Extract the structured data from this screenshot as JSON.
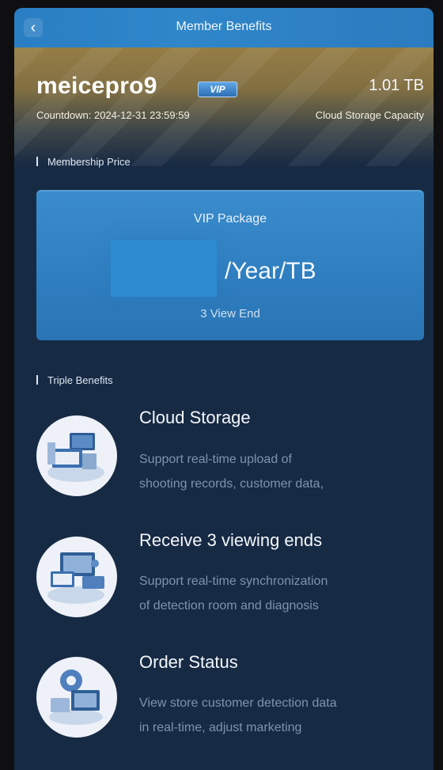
{
  "header": {
    "title": "Member Benefits",
    "back_icon": "chevron-left-icon"
  },
  "profile": {
    "username": "meicepro9",
    "badge": "VIP",
    "capacity": "1.01 TB",
    "countdown": "Countdown: 2024-12-31 23:59:59",
    "capacity_label": "Cloud Storage Capacity"
  },
  "membership_price": {
    "section_title": "Membership Price",
    "package_name": "VIP Package",
    "unit": "/Year/TB",
    "views": "3 View End"
  },
  "triple_benefits": {
    "section_title": "Triple Benefits",
    "items": [
      {
        "title": "Cloud Storage",
        "desc_line1": "Support real-time upload of",
        "desc_line2": "shooting records, customer data,",
        "icon": "cloud-storage-icon"
      },
      {
        "title": "Receive 3 viewing ends",
        "desc_line1": "Support real-time synchronization",
        "desc_line2": "of detection room and diagnosis",
        "icon": "viewing-ends-icon"
      },
      {
        "title": "Order Status",
        "desc_line1": "View store customer detection data",
        "desc_line2": "in real-time, adjust marketing",
        "icon": "order-status-icon"
      }
    ]
  },
  "colors": {
    "accent": "#2e8bd1",
    "background": "#172a44",
    "gold": "#9c8145"
  }
}
